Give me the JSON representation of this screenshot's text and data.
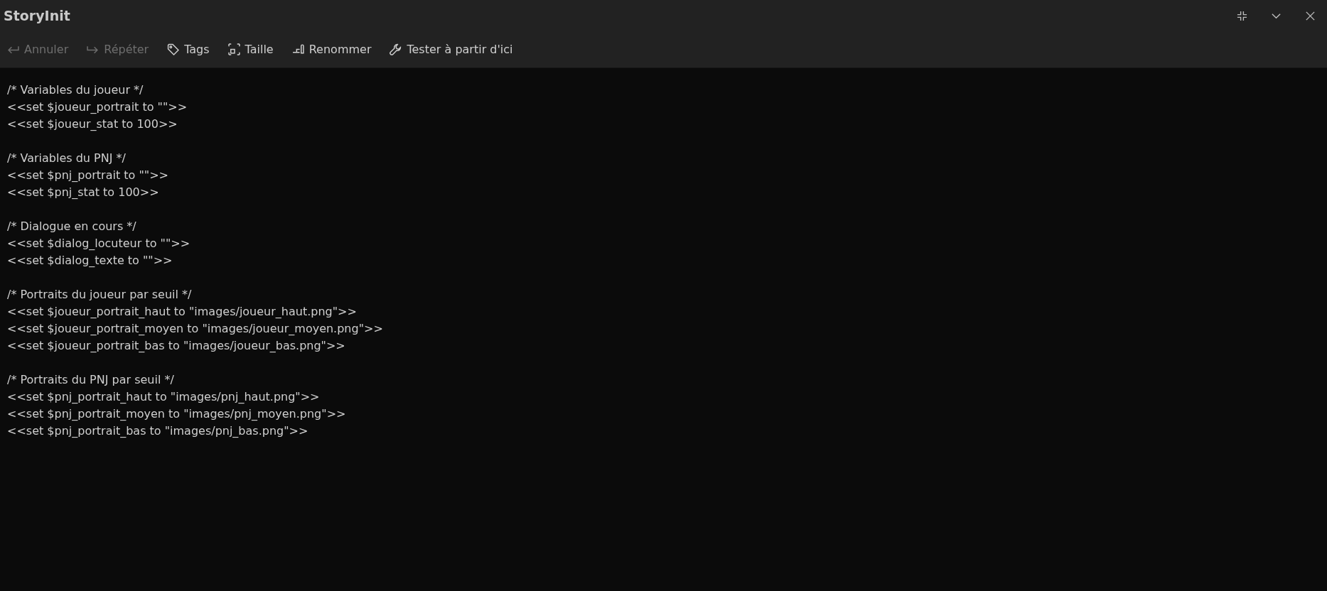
{
  "window": {
    "title": "StoryInit",
    "controls": [
      {
        "kind": "collapse"
      },
      {
        "kind": "chevron"
      },
      {
        "kind": "close"
      }
    ]
  },
  "toolbar": [
    {
      "label": "Annuler",
      "kind": "undo",
      "disabled": true
    },
    {
      "label": "Répéter",
      "kind": "redo",
      "disabled": true
    },
    {
      "label": "Tags",
      "kind": "tag",
      "disabled": false
    },
    {
      "label": "Taille",
      "kind": "resize",
      "disabled": false
    },
    {
      "label": "Renommer",
      "kind": "rename",
      "disabled": false
    },
    {
      "label": "Tester à partir d'ici",
      "kind": "wrench",
      "disabled": false
    }
  ],
  "editor": {
    "blocks": [
      {
        "lines": [
          "/* Variables du joueur */",
          "<<set $joueur_portrait to \"\">>",
          "<<set $joueur_stat to 100>>"
        ]
      },
      {
        "lines": [
          "/* Variables du PNJ */",
          "<<set $pnj_portrait to \"\">>",
          "<<set $pnj_stat to 100>>"
        ]
      },
      {
        "lines": [
          "/* Dialogue en cours */",
          "<<set $dialog_locuteur to \"\">>",
          "<<set $dialog_texte to \"\">>"
        ]
      },
      {
        "lines": [
          "/* Portraits du joueur par seuil */",
          "<<set $joueur_portrait_haut to \"images/joueur_haut.png\">>",
          "<<set $joueur_portrait_moyen to \"images/joueur_moyen.png\">>",
          "<<set $joueur_portrait_bas to \"images/joueur_bas.png\">>"
        ]
      },
      {
        "lines": [
          "/* Portraits du PNJ par seuil */",
          "<<set $pnj_portrait_haut to \"images/pnj_haut.png\">>",
          "<<set $pnj_portrait_moyen to \"images/pnj_moyen.png\">>",
          "<<set $pnj_portrait_bas to \"images/pnj_bas.png\">>"
        ]
      }
    ]
  }
}
